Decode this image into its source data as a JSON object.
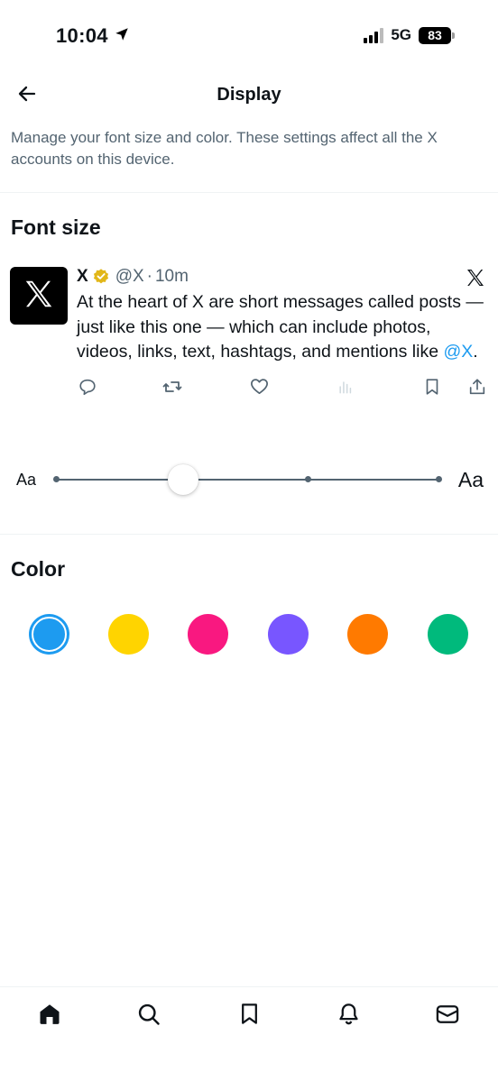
{
  "status_bar": {
    "time": "10:04",
    "network": "5G",
    "battery": "83"
  },
  "header": {
    "title": "Display"
  },
  "description": "Manage your font size and color. These settings affect all the X accounts on this device.",
  "font_size": {
    "title": "Font size",
    "slider_min_label": "Aa",
    "slider_max_label": "Aa",
    "slider_value": 0.33
  },
  "sample_post": {
    "name": "X",
    "handle": "@X",
    "separator": "·",
    "time": "10m",
    "text_before_mention": "At the heart of X are short messages called posts — just like this one — which can include photos, videos, links, text, hashtags, and mentions like ",
    "mention": "@X",
    "text_after_mention": "."
  },
  "color": {
    "title": "Color",
    "swatches": [
      "#1d9bf0",
      "#ffd400",
      "#f91880",
      "#7856ff",
      "#ff7a00",
      "#00ba7c"
    ],
    "selected_index": 0
  },
  "tab_bar": {
    "items": [
      "home-icon",
      "search-icon",
      "bookmark-icon",
      "notifications-icon",
      "messages-icon"
    ]
  }
}
